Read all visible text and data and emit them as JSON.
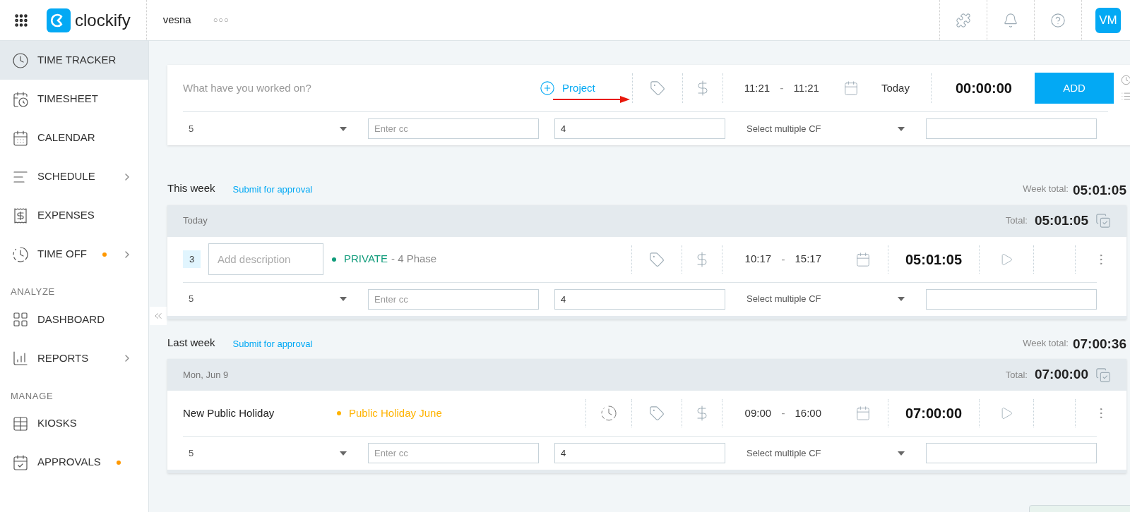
{
  "header": {
    "logo": "clockify",
    "workspace": "vesna",
    "more": "○○○",
    "avatar": "VM"
  },
  "sidebar": {
    "sections": [
      {
        "items": [
          {
            "label": "TIME TRACKER",
            "selected": true,
            "submenu": false,
            "dot": false
          },
          {
            "label": "TIMESHEET",
            "selected": false,
            "submenu": false,
            "dot": false
          },
          {
            "label": "CALENDAR",
            "selected": false,
            "submenu": false,
            "dot": false
          },
          {
            "label": "SCHEDULE",
            "selected": false,
            "submenu": true,
            "dot": false
          },
          {
            "label": "EXPENSES",
            "selected": false,
            "submenu": false,
            "dot": false
          },
          {
            "label": "TIME OFF",
            "selected": false,
            "submenu": true,
            "dot": true
          }
        ]
      },
      {
        "heading": "ANALYZE",
        "items": [
          {
            "label": "DASHBOARD",
            "selected": false,
            "submenu": false,
            "dot": false
          },
          {
            "label": "REPORTS",
            "selected": false,
            "submenu": true,
            "dot": false
          }
        ]
      },
      {
        "heading": "MANAGE",
        "items": [
          {
            "label": "KIOSKS",
            "selected": false,
            "submenu": false,
            "dot": false
          },
          {
            "label": "APPROVALS",
            "selected": false,
            "submenu": false,
            "dot": true
          }
        ]
      }
    ]
  },
  "tracker": {
    "placeholder": "What have you worked on?",
    "project": "Project",
    "start": "11:21",
    "separator": "-",
    "end": "11:21",
    "date": "Today",
    "duration": "00:00:00",
    "add": "ADD",
    "fields": [
      {
        "kind": "select",
        "value": "5"
      },
      {
        "kind": "input",
        "placeholder": "Enter cc"
      },
      {
        "kind": "input",
        "value": "4"
      },
      {
        "kind": "select",
        "value": "Select multiple CF"
      },
      {
        "kind": "input"
      }
    ]
  },
  "weeks": [
    {
      "label": "This week",
      "submit": "Submit for approval",
      "total_label": "Week total:",
      "total": "05:01:05",
      "days": [
        {
          "label": "Today",
          "total_label": "Total:",
          "total": "05:01:05",
          "entries": [
            {
              "kind": "editable",
              "badge": "3",
              "placeholder": "Add description",
              "project": "PRIVATE",
              "color": "#0f9b7a",
              "task_separator": "-",
              "task": "4 Phase",
              "start": "10:17",
              "separator": "-",
              "end": "15:17",
              "duration": "05:01:05",
              "fields": [
                {
                  "kind": "select",
                  "value": "5"
                },
                {
                  "kind": "input",
                  "placeholder": "Enter cc"
                },
                {
                  "kind": "input",
                  "value": "4"
                },
                {
                  "kind": "select",
                  "value": "Select multiple CF"
                },
                {
                  "kind": "input"
                }
              ]
            }
          ]
        }
      ]
    },
    {
      "label": "Last week",
      "submit": "Submit for approval",
      "total_label": "Week total:",
      "total": "07:00:36",
      "days": [
        {
          "label": "Mon, Jun 9",
          "total_label": "Total:",
          "total": "07:00:00",
          "entries": [
            {
              "kind": "time_off",
              "description": "New Public Holiday",
              "project": "Public Holiday June",
              "color": "#ffb300",
              "start": "09:00",
              "separator": "-",
              "end": "16:00",
              "duration": "07:00:00",
              "fields": [
                {
                  "kind": "select",
                  "value": "5"
                },
                {
                  "kind": "input",
                  "placeholder": "Enter cc"
                },
                {
                  "kind": "input",
                  "value": "4"
                },
                {
                  "kind": "select",
                  "value": "Select multiple CF"
                },
                {
                  "kind": "input"
                }
              ]
            }
          ]
        }
      ]
    }
  ]
}
